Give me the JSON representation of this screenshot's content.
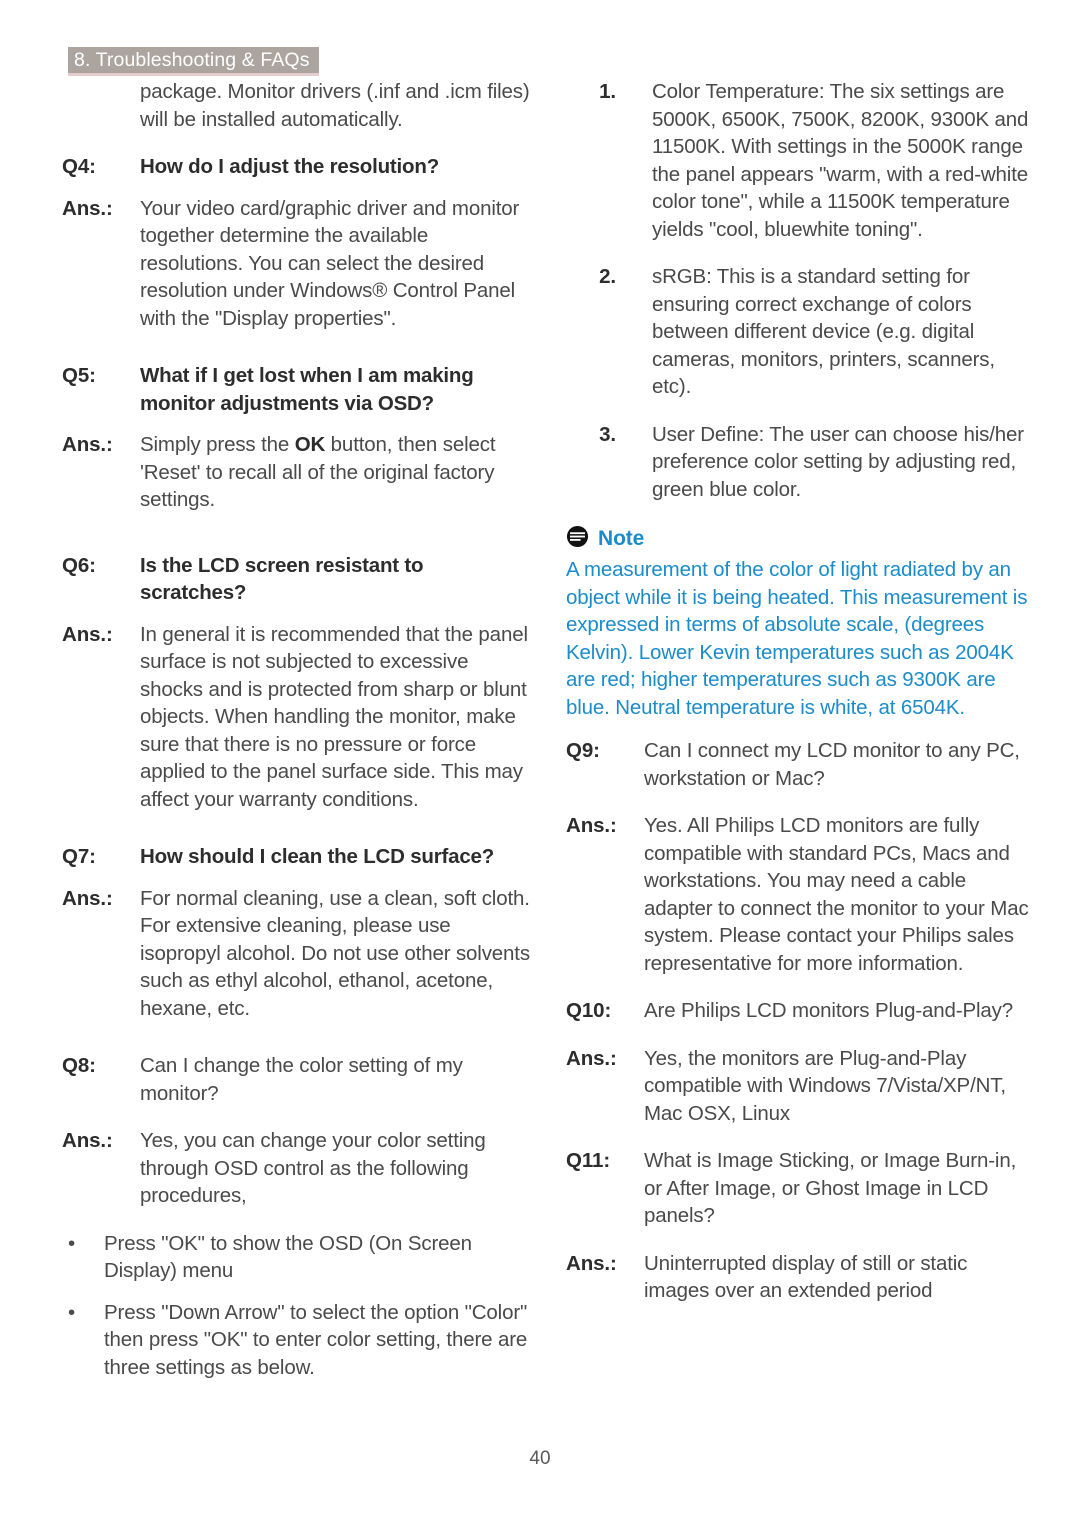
{
  "header": {
    "tab_label": "8. Troubleshooting & FAQs",
    "tab_bg": "#aba49f",
    "tab_text_color": "#ffffff",
    "tab_underline": "#e6cccb"
  },
  "left_column": {
    "carryover_paragraph": "package. Monitor drivers (.inf and .icm files) will be installed automatically.",
    "q4": {
      "label": "Q4:",
      "question": "How do I adjust the resolution?",
      "ans_label": "Ans.:",
      "answer": "Your video card/graphic driver and monitor together determine the available resolutions. You can select the desired resolution under Windows® Control Panel with the \"Display properties\"."
    },
    "q5": {
      "label": "Q5:",
      "question": "What if I get lost when I am making monitor adjustments via OSD?",
      "ans_label": "Ans.:",
      "answer_part1": "Simply press the ",
      "answer_bold": "OK",
      "answer_part2": " button, then select 'Reset' to recall all of the original factory settings."
    },
    "q6": {
      "label": "Q6:",
      "question": "Is the LCD screen resistant to scratches?",
      "ans_label": "Ans.:",
      "answer": "In general it is recommended that the panel surface is not subjected to excessive shocks and is protected from sharp or blunt objects. When handling the monitor, make sure that there is no pressure or force applied to the panel surface side. This may affect your warranty conditions."
    },
    "q7": {
      "label": "Q7:",
      "question": "How should I clean the LCD surface?",
      "ans_label": "Ans.:",
      "answer": "For normal cleaning, use a clean, soft cloth. For extensive cleaning, please use isopropyl alcohol. Do not use other solvents such as ethyl alcohol, ethanol, acetone, hexane, etc."
    },
    "q8": {
      "label": "Q8:",
      "question": "Can I change the color setting of my monitor?",
      "ans_label": "Ans.:",
      "answer": "Yes, you can change your color setting through OSD control as the following procedures,"
    },
    "bullets": [
      {
        "marker": "•",
        "text": "Press \"OK\" to show the OSD (On Screen Display) menu"
      },
      {
        "marker": "•",
        "text": "Press \"Down Arrow\" to select the option \"Color\" then press \"OK\" to enter color setting, there are three settings as below."
      }
    ]
  },
  "right_column": {
    "numbered_items": [
      {
        "marker": "1.",
        "text": "Color Temperature: The six settings are 5000K, 6500K, 7500K, 8200K, 9300K and 11500K. With settings in the 5000K range the panel appears \"warm, with a red-white color tone\", while a 11500K temperature yields \"cool, bluewhite toning\"."
      },
      {
        "marker": "2.",
        "text": "sRGB: This is a standard setting for ensuring correct exchange of colors between different device (e.g. digital cameras, monitors, printers, scanners, etc)."
      },
      {
        "marker": "3.",
        "text": "User Define: The user can choose his/her preference color setting by adjusting red, green blue color."
      }
    ],
    "note": {
      "icon_name": "note-icon",
      "title": "Note",
      "color": "#1b8cc9",
      "body": "A measurement of the color of light radiated by an object while it is being heated. This measurement is expressed in terms of absolute scale, (degrees Kelvin). Lower Kevin temperatures such as 2004K are red; higher temperatures such as 9300K are blue. Neutral temperature is white, at 6504K."
    },
    "q9": {
      "label": "Q9:",
      "question": "Can I connect my LCD monitor to any PC, workstation or Mac?",
      "ans_label": "Ans.:",
      "answer": "Yes. All Philips LCD monitors are fully compatible with standard PCs, Macs and workstations. You may need a cable adapter to connect the monitor to your Mac system. Please contact your Philips sales representative for more information."
    },
    "q10": {
      "label": "Q10:",
      "question": "Are Philips LCD monitors Plug-and-Play?",
      "ans_label": "Ans.:",
      "answer": "Yes, the monitors are Plug-and-Play compatible with Windows 7/Vista/XP/NT, Mac OSX, Linux"
    },
    "q11": {
      "label": "Q11:",
      "question": "What is Image Sticking, or Image Burn-in, or After Image, or Ghost Image in LCD panels?",
      "ans_label": "Ans.:",
      "answer": "Uninterrupted display of still or static images over an extended period"
    }
  },
  "footer": {
    "page_number": "40"
  }
}
